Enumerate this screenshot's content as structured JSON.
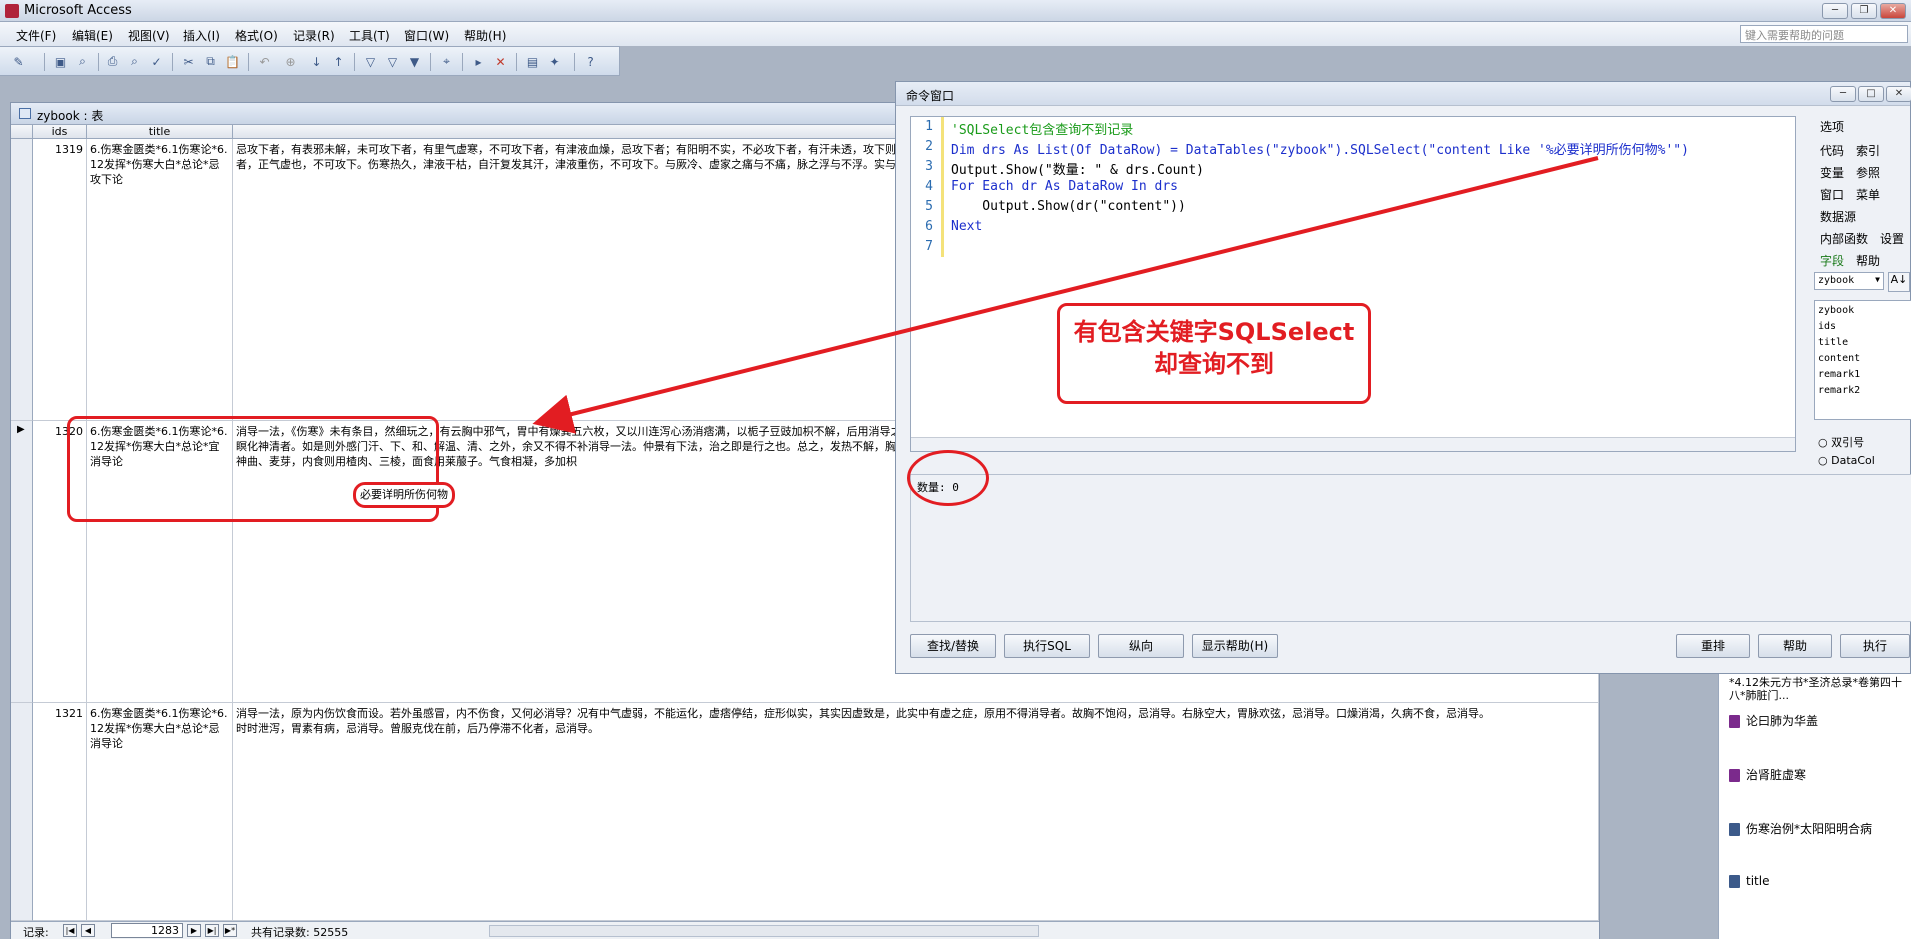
{
  "app": {
    "title": "Microsoft Access",
    "help_placeholder": "键入需要帮助的问题"
  },
  "menu": [
    "文件(F)",
    "编辑(E)",
    "视图(V)",
    "插入(I)",
    "格式(O)",
    "记录(R)",
    "工具(T)",
    "窗口(W)",
    "帮助(H)"
  ],
  "table": {
    "window_title": "zybook : 表",
    "columns": [
      "ids",
      "title",
      "content"
    ],
    "rows": [
      {
        "ids": "1319",
        "title": "6.伤寒金匮类*6.1伤寒论*6.12发挥*伤寒大白*总论*忌攻下论",
        "content": "忌攻下者，有表邪未解，未可攻下者，有里气虚寒，不可攻下者，有津液血燥，忌攻下者；有阳明不实，不必攻下者，有汗未透，攻下则邪伏者；有未足不温，攻下则脉伏不出者。故曰：恶寒身痛，太阳症未罢，不可下。结胸症，脉浮大，不可攻下。脉虚细者，正气虚也，不可攻下。伤寒热久，津液干枯，自汗复发其汗，津液重伤，不可攻下。与厥冷、虚家之痛与不痛，脉之浮与不浮。实与不实，汗之多与不多，小便之利与不利，里热之甚与不甚，津液之干与不干，屎之硬与"
      },
      {
        "ids": "1320",
        "title": "6.伤寒金匮类*6.1伤寒论*6.12发挥*伤寒大白*总论*宜消导论",
        "content": "消导一法，《伤寒》未有条目，然细玩之，有云胸中邪气，胃中有燥粪五六枚，又以川连泻心汤消痞满，以栀子豆豉加枳不解，后用消导之法而汗出病愈者。又尝用清里之药而里热不除，后用消导而热退者。又尝治瘀妄，用清热之味不效，后底见昏沉，用消导而瞑化神清者。如是则外感门汗、下、和、解温、清、之外，余又不得不补消导一法。仲景有下法，治之即是行之也。总之，发热不解，胸前饱闷，宜消导；瘀妄，口不干渴不消水，脉大不数者，此食滞中焦也，导。然消导之法，必要详明所伤何物，如谷食则用神曲、麦芽，内食则用楂肉、三棱，面食用莱菔子。气食相凝，多加枳"
      },
      {
        "ids": "1321",
        "title": "6.伤寒金匮类*6.1伤寒论*6.12发挥*伤寒大白*总论*忌消导论",
        "content": "消导一法，原为内伤饮食而设。若外虽感冒，内不伤食，又何必消导？况有中气虚弱，不能运化，虚痞停结，症形似实，其实因虚致是，此实中有虚之症，原用不得消导者。故胸不饱闷，忌消导。右脉空大，胃脉欢弦，忌消导。口燥消渴，久病不食，忌消导。时时泄泻，胃素有病，忌消导。曾服克伐在前，后乃停滞不化者，忌消导。"
      }
    ],
    "status": {
      "label": "记录:",
      "current": "1283",
      "total": "共有记录数: 52555"
    }
  },
  "command": {
    "window_title": "命令窗口",
    "code_lines": [
      {
        "n": "1",
        "text": "'SQLSelect包含查询不到记录"
      },
      {
        "n": "2",
        "text": "Dim drs As List(Of DataRow) = DataTables(\"zybook\").SQLSelect(\"content Like '%必要详明所伤何物%'\")"
      },
      {
        "n": "3",
        "text": "Output.Show(\"数量: \" & drs.Count)"
      },
      {
        "n": "4",
        "text": "For Each dr As DataRow In drs"
      },
      {
        "n": "5",
        "text": "    Output.Show(dr(\"content\"))"
      },
      {
        "n": "6",
        "text": "Next"
      },
      {
        "n": "7",
        "text": ""
      }
    ],
    "output_text": "数量: 0",
    "side_items": [
      "选项",
      "代码",
      "索引",
      "变量",
      "参照",
      "窗口",
      "菜单",
      "数据源",
      "内部函数",
      "设置",
      "字段",
      "帮助"
    ],
    "field_combo": "zybook",
    "fields": [
      "zybook",
      "ids",
      "title",
      "content",
      "remark1",
      "remark2"
    ],
    "radios": [
      "双引号",
      "DataCol"
    ],
    "buttons": {
      "find": "查找/替换",
      "exec_sql": "执行SQL",
      "vertical": "纵向",
      "show_help": "显示帮助(H)",
      "rearrange": "重排",
      "help": "帮助",
      "execute": "执行"
    }
  },
  "tree": {
    "partial": "*4.12朱元方书*圣济总录*卷第四十八*肺脏门...",
    "items": [
      "论曰肺为华盖",
      "治肾脏虚寒",
      "伤寒治例*太阳阳明合病",
      "title"
    ]
  },
  "annotation": {
    "line1": "有包含关键字SQLSelect",
    "line2": "却查询不到",
    "highlight": "必要详明所伤何物"
  },
  "colors": {
    "accent": "#e21d22",
    "keyword": "#1c2fcc",
    "comment": "#1a9b1a",
    "string": "#b00020"
  }
}
